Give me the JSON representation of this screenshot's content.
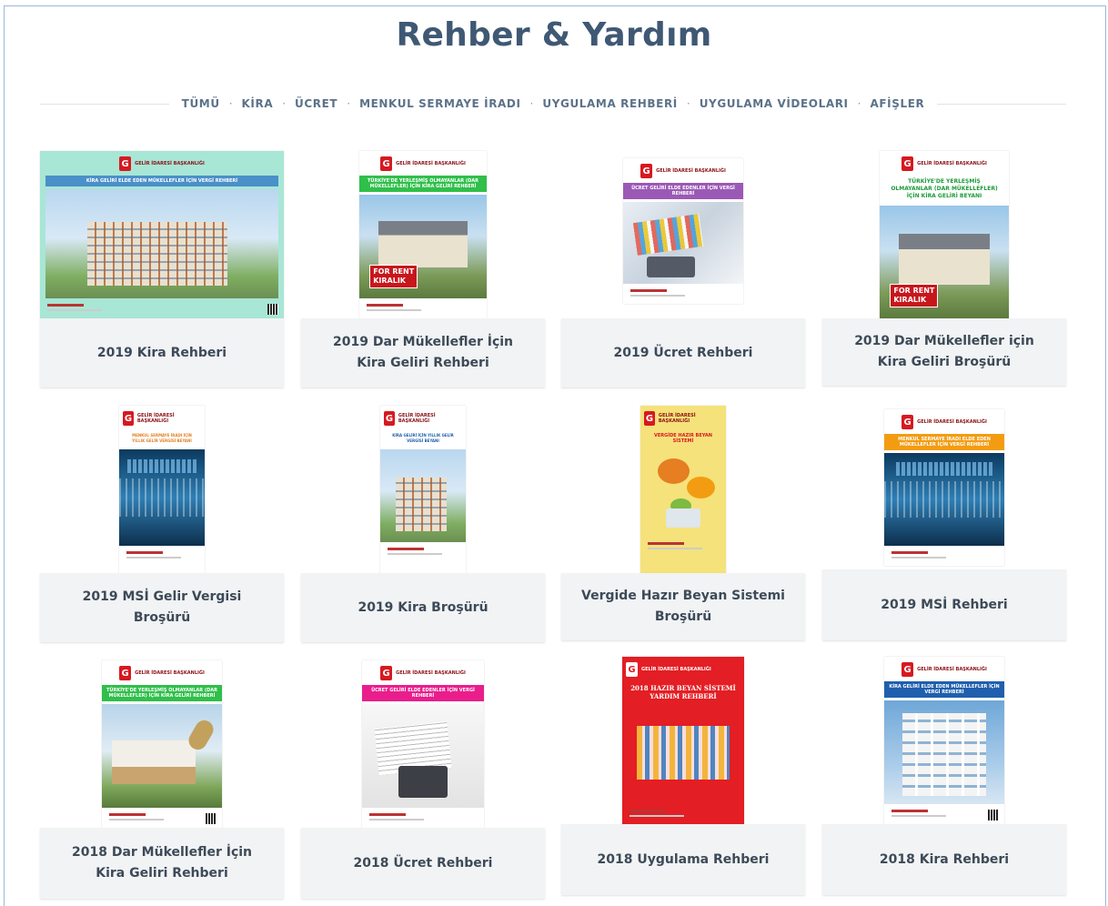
{
  "page": {
    "title": "Rehber & Yardım"
  },
  "filters": [
    {
      "label": "TÜMÜ"
    },
    {
      "label": "KİRA"
    },
    {
      "label": "ÜCRET"
    },
    {
      "label": "MENKUL SERMAYE İRADI"
    },
    {
      "label": "UYGULAMA REHBERİ"
    },
    {
      "label": "UYGULAMA VİDEOLARI"
    },
    {
      "label": "AFİŞLER"
    }
  ],
  "cards": [
    {
      "title": "2019 Kira Rehberi",
      "cover_color": "#a8e6d6",
      "band_color": "#4a90c9",
      "cover_text": "KİRA GELİRİ ELDE EDEN MÜKELLEFLER İÇİN VERGİ REHBERİ",
      "logo_text": "GELİR İDARESİ BAŞKANLIĞI"
    },
    {
      "title": "2019 Dar Mükellefler İçin Kira Geliri Rehberi",
      "cover_color": "#ffffff",
      "band_color": "#2fbf4a",
      "cover_text": "TÜRKİYE'DE YERLEŞMİŞ OLMAYANLAR (DAR MÜKELLEFLER) İÇİN KİRA GELİRİ REHBERİ",
      "logo_text": "GELİR İDARESİ BAŞKANLIĞI"
    },
    {
      "title": "2019 Ücret Rehberi",
      "cover_color": "#ffffff",
      "band_color": "#9b59b6",
      "cover_text": "ÜCRET GELİRİ ELDE EDENLER İÇİN VERGİ REHBERİ",
      "logo_text": "GELİR İDARESİ BAŞKANLIĞI"
    },
    {
      "title": "2019 Dar Mükellefler için Kira Geliri Broşürü",
      "cover_color": "#ffffff",
      "band_color": "#ffffff",
      "cover_text": "TÜRKİYE'DE YERLEŞMİŞ OLMAYANLAR (DAR MÜKELLEFLER) İÇİN KİRA GELİRİ BEYANI",
      "logo_text": "GELİR İDARESİ BAŞKANLIĞI"
    },
    {
      "title": "2019 MSİ Gelir Vergisi Broşürü",
      "cover_color": "#ffffff",
      "band_color": "#f39c12",
      "cover_text": "MENKUL SERMAYE İRADI İÇİN YILLIK GELİR VERGİSİ BEYANI",
      "logo_text": "GELİR İDARESİ BAŞKANLIĞI"
    },
    {
      "title": "2019 Kira Broşürü",
      "cover_color": "#ffffff",
      "band_color": "#ffffff",
      "cover_text": "KİRA GELİRİ İÇİN YILLIK GELİR VERGİSİ BEYANI",
      "logo_text": "GELİR İDARESİ BAŞKANLIĞI"
    },
    {
      "title": "Vergide Hazır Beyan Sistemi Broşürü",
      "cover_color": "#f5e27a",
      "band_color": "#f5e27a",
      "cover_text": "VERGİDE HAZIR BEYAN SİSTEMİ",
      "logo_text": "GELİR İDARESİ BAŞKANLIĞI"
    },
    {
      "title": "2019 MSİ Rehberi",
      "cover_color": "#ffffff",
      "band_color": "#f39c12",
      "cover_text": "MENKUL SERMAYE İRADI ELDE EDEN MÜKELLEFLER İÇİN VERGİ REHBERİ",
      "logo_text": "GELİR İDARESİ BAŞKANLIĞI"
    },
    {
      "title": "2018 Dar Mükellefler İçin Kira Geliri Rehberi",
      "cover_color": "#ffffff",
      "band_color": "#2fbf4a",
      "cover_text": "TÜRKİYE'DE YERLEŞMİŞ OLMAYANLAR (DAR MÜKELLEFLER) İÇİN KİRA GELİRİ REHBERİ",
      "logo_text": "GELİR İDARESİ BAŞKANLIĞI"
    },
    {
      "title": "2018 Ücret Rehberi",
      "cover_color": "#ffffff",
      "band_color": "#e91e8c",
      "cover_text": "ÜCRET GELİRİ ELDE EDENLER İÇİN VERGİ REHBERİ",
      "logo_text": "GELİR İDARESİ BAŞKANLIĞI"
    },
    {
      "title": "2018 Uygulama Rehberi",
      "cover_color": "#e31e24",
      "band_color": "#e31e24",
      "cover_text": "2018 HAZIR BEYAN SİSTEMİ YARDIM REHBERİ",
      "logo_text": "GELİR İDARESİ BAŞKANLIĞI"
    },
    {
      "title": "2018 Kira Rehberi",
      "cover_color": "#ffffff",
      "band_color": "#1f5fae",
      "cover_text": "KİRA GELİRİ ELDE EDEN MÜKELLEFLER İÇİN VERGİ REHBERİ",
      "logo_text": "GELİR İDARESİ BAŞKANLIĞI"
    }
  ]
}
